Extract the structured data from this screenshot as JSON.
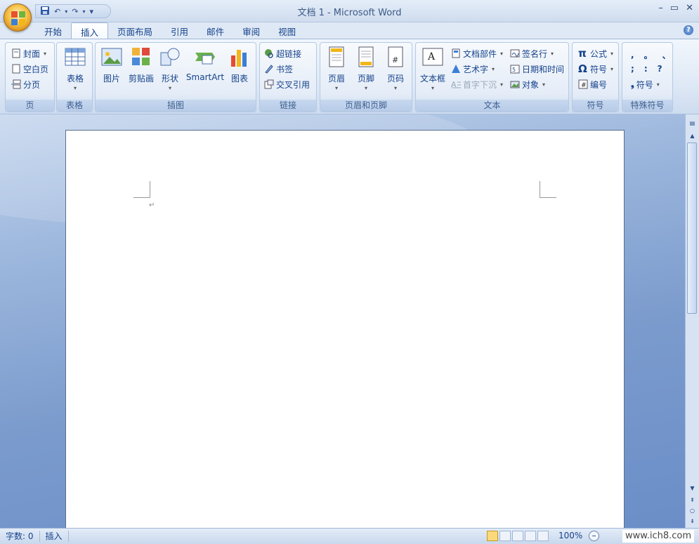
{
  "window": {
    "title": "文档 1 - Microsoft Word"
  },
  "qat": {
    "save": "💾",
    "undo": "↶",
    "redo": "↷",
    "more": "▾"
  },
  "tabs": [
    "开始",
    "插入",
    "页面布局",
    "引用",
    "邮件",
    "审阅",
    "视图"
  ],
  "active_tab": "插入",
  "ribbon": {
    "page": {
      "label": "页",
      "cover": "封面",
      "blank": "空白页",
      "break": "分页"
    },
    "table": {
      "label": "表格",
      "btn": "表格"
    },
    "illustrations": {
      "label": "插图",
      "picture": "图片",
      "clipart": "剪贴画",
      "shapes": "形状",
      "smartart": "SmartArt",
      "chart": "图表"
    },
    "links": {
      "label": "链接",
      "hyperlink": "超链接",
      "bookmark": "书签",
      "crossref": "交叉引用"
    },
    "headerfooter": {
      "label": "页眉和页脚",
      "header": "页眉",
      "footer": "页脚",
      "pagenum": "页码"
    },
    "text": {
      "label": "文本",
      "textbox": "文本框",
      "quickparts": "文档部件",
      "wordart": "艺术字",
      "dropcap": "首字下沉",
      "signature": "签名行",
      "datetime": "日期和时间",
      "object": "对象"
    },
    "symbols": {
      "label": "符号",
      "equation": "公式",
      "symbol": "符号",
      "numbering": "编号"
    },
    "special": {
      "label": "特殊符号",
      "chars": [
        ",",
        "。",
        "、",
        ";",
        ":",
        "?"
      ],
      "more": "符号"
    }
  },
  "status": {
    "wordcount": "字数: 0",
    "mode": "插入",
    "zoom": "100%"
  },
  "watermark": "www.ich8.com",
  "colors": {
    "accent": "#15428b",
    "ribbon_bg": "#dfe9f5",
    "doc_bg": "#7b9bcd"
  }
}
